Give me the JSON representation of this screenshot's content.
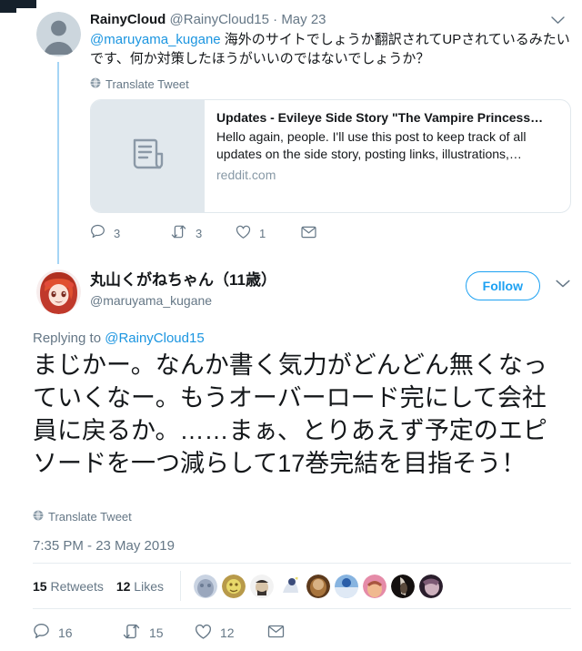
{
  "parent_tweet": {
    "display_name": "RainyCloud",
    "handle": "@RainyCloud15",
    "separator": "·",
    "date": "May 23",
    "mention": "@maruyama_kugane",
    "body": " 海外のサイトでしょうか翻訳されてUPされているみたいです、何か対策したほうがいいのではないでしょうか？",
    "translate_label": "Translate Tweet",
    "caret_icon": "chevron-down-icon",
    "link_card": {
      "title": "Updates - Evileye Side Story \"The Vampire Princess…",
      "description": "Hello again, people. I'll use this post to keep track of all updates on the side story, posting links, illustrations,…",
      "domain": "reddit.com",
      "thumb_icon": "news-article-icon"
    },
    "actions": {
      "reply": {
        "icon": "reply-icon",
        "count": "3"
      },
      "retweet": {
        "icon": "retweet-icon",
        "count": "3"
      },
      "like": {
        "icon": "heart-icon",
        "count": "1"
      },
      "share": {
        "icon": "envelope-icon",
        "count": ""
      }
    }
  },
  "main_tweet": {
    "display_name": "丸山くがねちゃん（11歳）",
    "handle": "@maruyama_kugane",
    "follow_label": "Follow",
    "caret_icon": "chevron-down-icon",
    "replying_to_prefix": "Replying to ",
    "replying_to_handle": "@RainyCloud15",
    "body": "まじかー。なんか書く気力がどんどん無くなっていくなー。もうオーバーロード完にして会社員に戻るか。……まぁ、とりあえず予定のエピソードを一つ減らして17巻完結を目指そう！",
    "translate_label": "Translate Tweet",
    "datetime": "7:35 PM - 23 May 2019",
    "stats": {
      "retweets_count": "15",
      "retweets_label": "Retweets",
      "likes_count": "12",
      "likes_label": "Likes"
    },
    "facepile": [
      {
        "name": "liker-avatar-1",
        "colors": [
          "#9aa7bd",
          "#c9d3e2",
          "#6b7b94"
        ]
      },
      {
        "name": "liker-avatar-2",
        "colors": [
          "#b89a4a",
          "#e8d96a",
          "#7a6020"
        ]
      },
      {
        "name": "liker-avatar-3",
        "colors": [
          "#f2f2f2",
          "#d8c4a8",
          "#3a3330"
        ]
      },
      {
        "name": "liker-avatar-4",
        "colors": [
          "#ffffff",
          "#dde4ee",
          "#3b4c7a"
        ]
      },
      {
        "name": "liker-avatar-5",
        "colors": [
          "#a8743c",
          "#d8b183",
          "#5d3a1c"
        ]
      },
      {
        "name": "liker-avatar-6",
        "colors": [
          "#2b5ea8",
          "#87b4e0",
          "#dfe9f5"
        ]
      },
      {
        "name": "liker-avatar-7",
        "colors": [
          "#e58ba8",
          "#f0b98f",
          "#a8543f"
        ]
      },
      {
        "name": "liker-avatar-8",
        "colors": [
          "#14100f",
          "#d8d0c4",
          "#5a4a3c"
        ]
      },
      {
        "name": "liker-avatar-9",
        "colors": [
          "#2a1e2c",
          "#cdb0bd",
          "#7c5a74"
        ]
      }
    ],
    "actions": {
      "reply": {
        "icon": "reply-icon",
        "count": "16"
      },
      "retweet": {
        "icon": "retweet-icon",
        "count": "15"
      },
      "like": {
        "icon": "heart-icon",
        "count": "12"
      },
      "share": {
        "icon": "envelope-icon",
        "count": ""
      }
    }
  },
  "colors": {
    "accent": "#1da1f2",
    "link": "#1b95e0",
    "text": "#14171a",
    "muted": "#657786",
    "divider": "#e6ecf0",
    "thread_line": "#a5d5f5",
    "card_thumb_bg": "#e1e8ed"
  }
}
